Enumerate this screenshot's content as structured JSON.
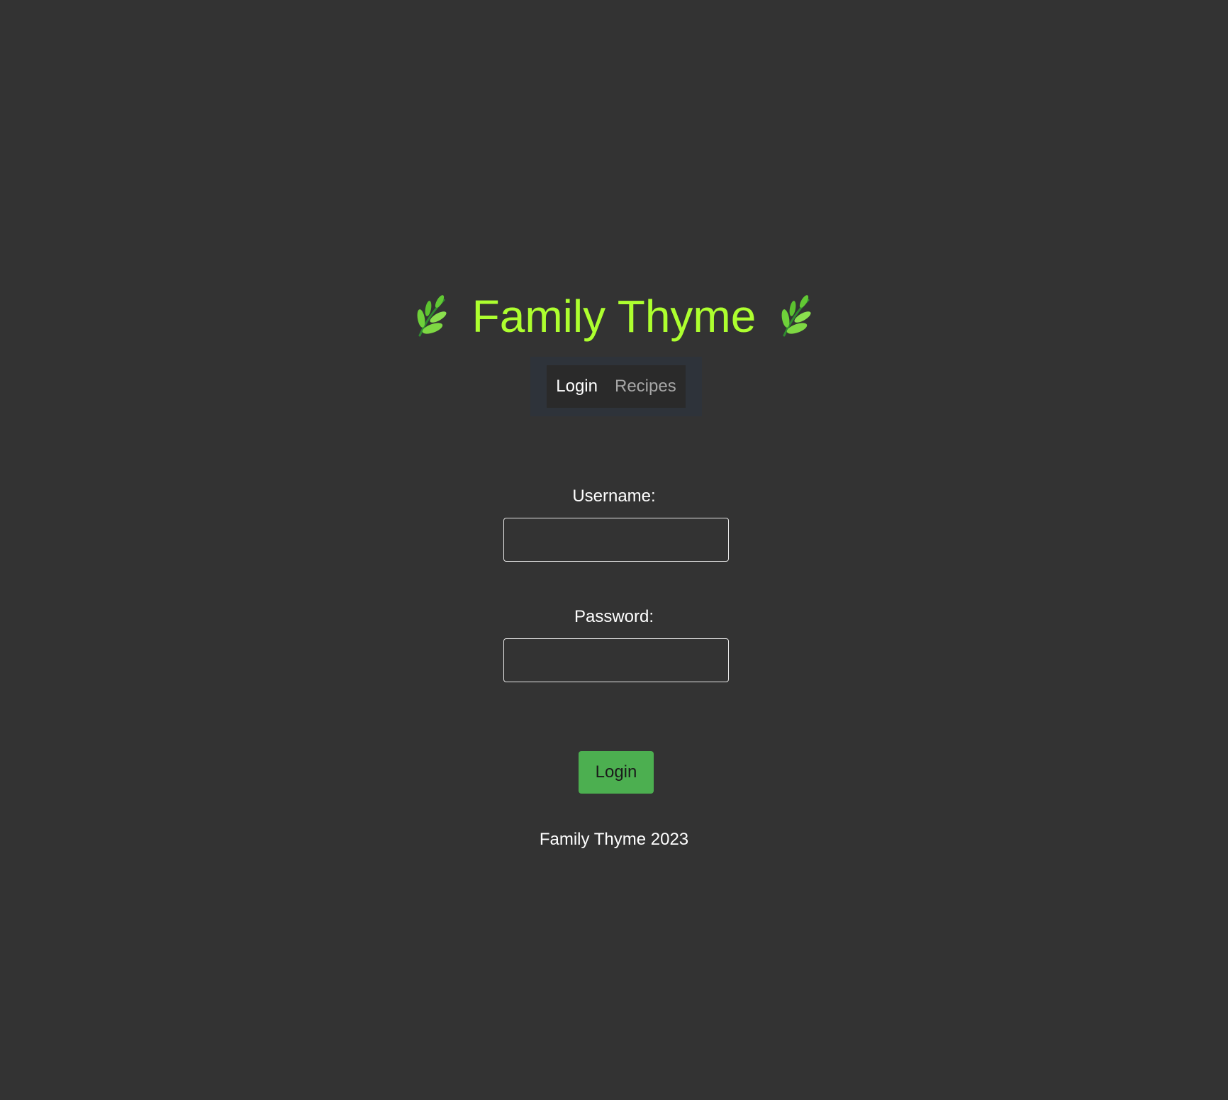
{
  "header": {
    "title": "Family Thyme",
    "left_icon": "herb-icon",
    "right_icon": "herb-icon",
    "title_color": "#adff2f"
  },
  "nav": {
    "items": [
      {
        "label": "Login",
        "active": true
      },
      {
        "label": "Recipes",
        "active": false
      }
    ]
  },
  "form": {
    "username_label": "Username:",
    "username_value": "",
    "password_label": "Password:",
    "password_value": "",
    "submit_label": "Login",
    "submit_color": "#4caf50"
  },
  "footer": {
    "text": "Family Thyme 2023"
  },
  "colors": {
    "background": "#333333",
    "accent": "#adff2f"
  }
}
